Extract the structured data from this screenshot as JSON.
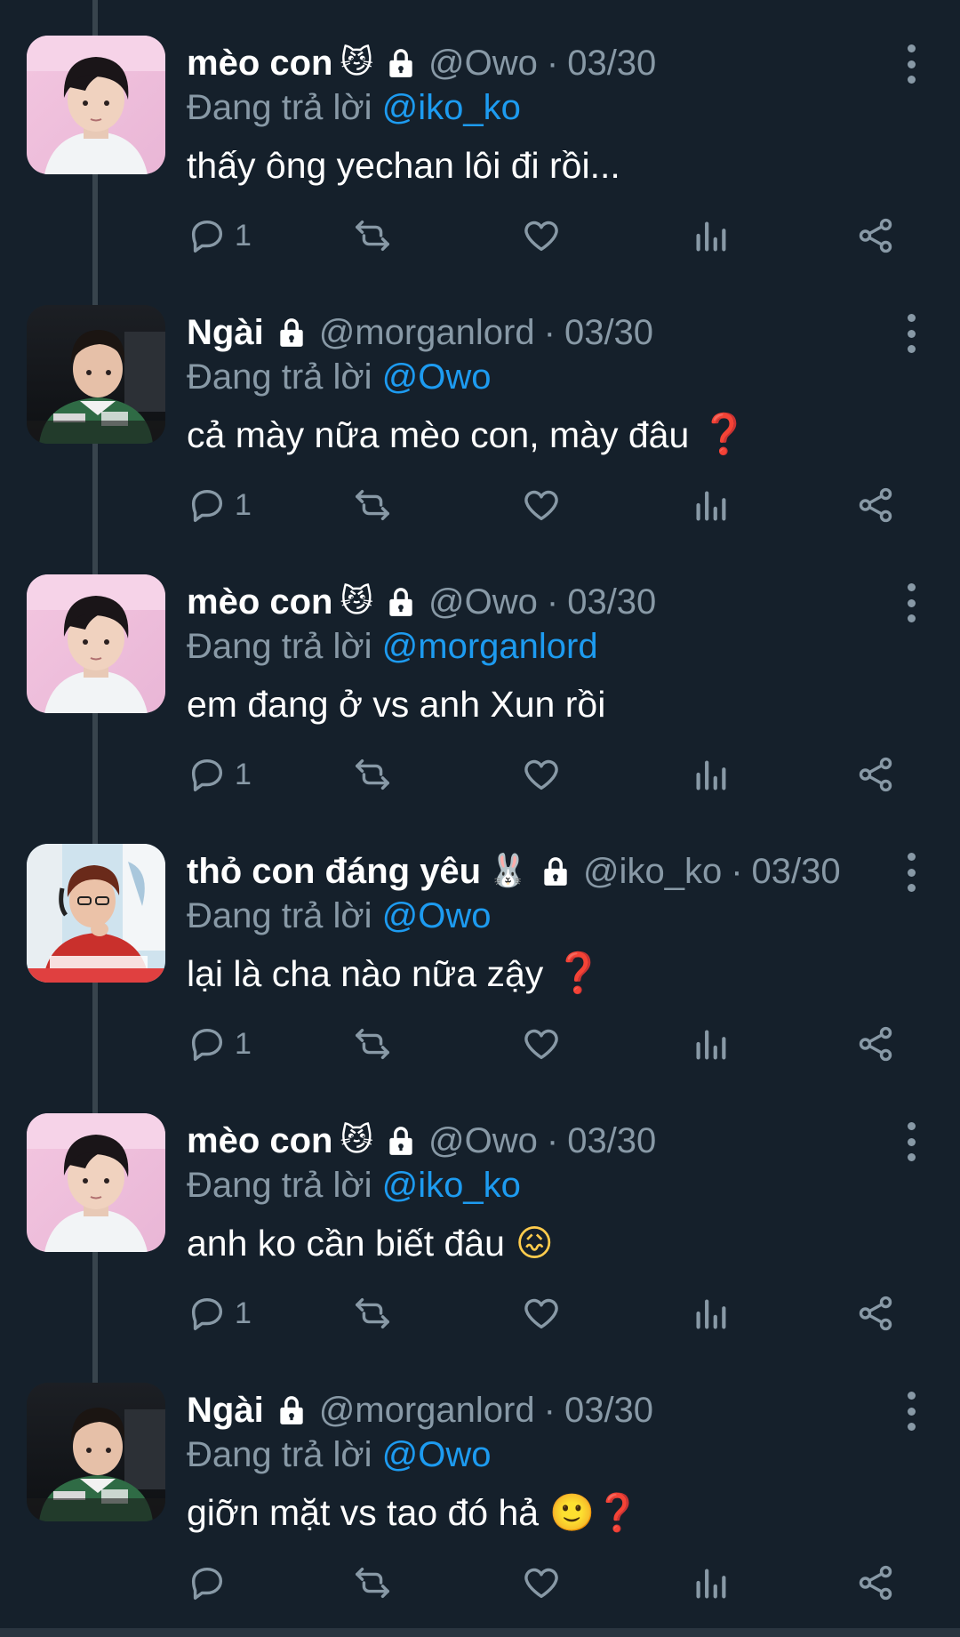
{
  "colors": {
    "background": "#15202b",
    "secondary_text": "#8899a6",
    "link": "#1d9bf0",
    "question_mark": "#e0245e"
  },
  "replying_prefix": "Đang trả lời",
  "tweets": [
    {
      "name": "mèo con",
      "name_emoji": "😼",
      "locked": true,
      "handle": "@Owo",
      "date": "03/30",
      "reply_to": "@iko_ko",
      "text": "thấy ông yechan lôi đi rồi...",
      "reply_count": "1",
      "avatar": "pink-background-avatar"
    },
    {
      "name": "Ngài",
      "name_emoji": "",
      "locked": true,
      "handle": "@morganlord",
      "date": "03/30",
      "reply_to": "@Owo",
      "text": "cả mày nữa mèo con, mày đâu",
      "text_suffix": "❓",
      "reply_count": "1",
      "avatar": "green-jersey-avatar"
    },
    {
      "name": "mèo con",
      "name_emoji": "😼",
      "locked": true,
      "handle": "@Owo",
      "date": "03/30",
      "reply_to": "@morganlord",
      "text": "em đang ở vs anh Xun rồi",
      "reply_count": "1",
      "avatar": "pink-background-avatar"
    },
    {
      "name": "thỏ con đáng yêu",
      "name_emoji": "🐰",
      "locked": true,
      "handle": "@iko_ko",
      "date": "03/30",
      "reply_to": "@Owo",
      "text": "lại là cha nào nữa zậy",
      "text_suffix": "❓",
      "reply_count": "1",
      "avatar": "red-jersey-avatar"
    },
    {
      "name": "mèo con",
      "name_emoji": "😼",
      "locked": true,
      "handle": "@Owo",
      "date": "03/30",
      "reply_to": "@iko_ko",
      "text": "anh ko cần biết đâu",
      "text_suffix": "😖",
      "reply_count": "1",
      "avatar": "pink-background-avatar"
    },
    {
      "name": "Ngài",
      "name_emoji": "",
      "locked": true,
      "handle": "@morganlord",
      "date": "03/30",
      "reply_to": "@Owo",
      "text": "giỡn mặt vs tao đó hả",
      "text_suffix": "🙂❓",
      "reply_count": "",
      "avatar": "green-jersey-avatar"
    }
  ]
}
